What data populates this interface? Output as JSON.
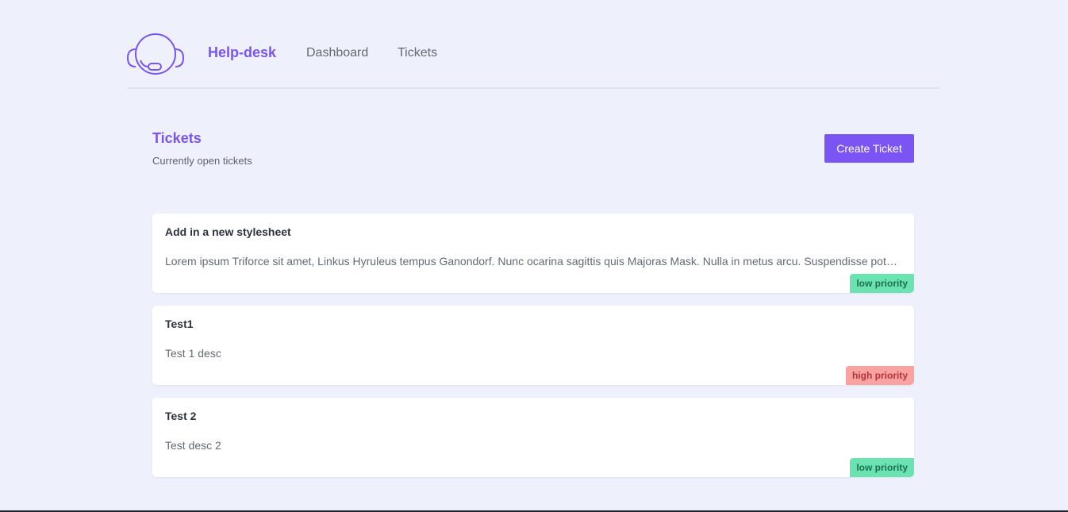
{
  "nav": {
    "brand": "Help-desk",
    "links": [
      "Dashboard",
      "Tickets"
    ]
  },
  "header": {
    "title": "Tickets",
    "subtitle": "Currently open tickets",
    "create_button": "Create Ticket"
  },
  "tickets": [
    {
      "title": "Add in a new stylesheet",
      "description": "Lorem ipsum Triforce sit amet, Linkus Hyruleus tempus Ganondorf. Nunc ocarina sagittis quis Majoras Mask. Nulla in metus arcu. Suspendisse potenti.",
      "priority": "low priority"
    },
    {
      "title": "Test1",
      "description": "Test 1 desc",
      "priority": "high priority"
    },
    {
      "title": "Test 2",
      "description": "Test desc 2",
      "priority": "low priority"
    }
  ],
  "colors": {
    "accent": "#7b54f4",
    "background": "#eef1fb",
    "low_priority": "#6ae3b0",
    "high_priority": "#f8a2a2"
  },
  "icons": {
    "logo": "headset-icon"
  }
}
